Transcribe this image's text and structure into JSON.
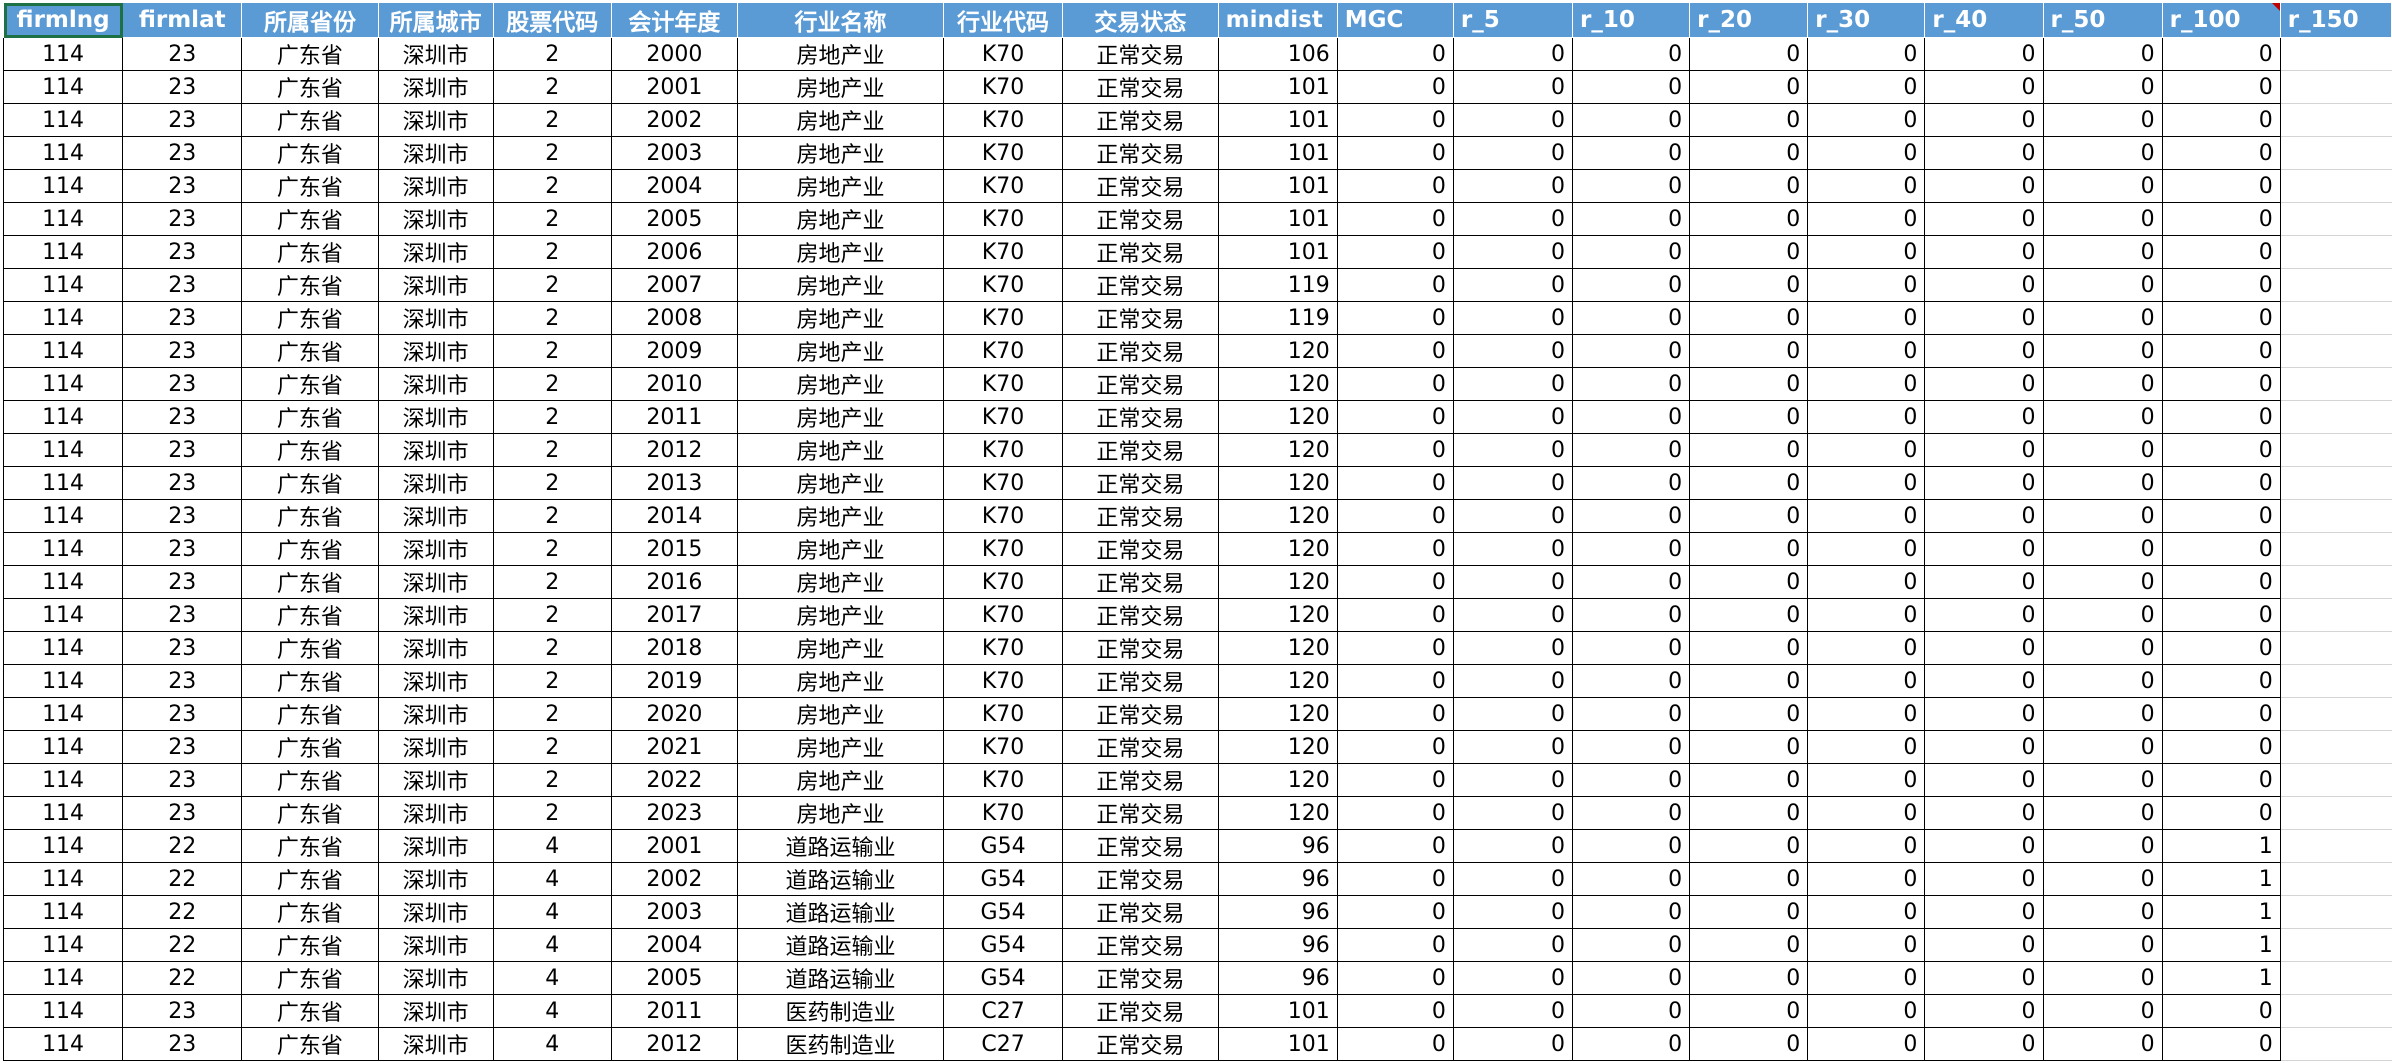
{
  "columns": [
    {
      "label": "firmlng",
      "align": "c",
      "header_align": "c"
    },
    {
      "label": "firmlat",
      "align": "c",
      "header_align": "c"
    },
    {
      "label": "所属省份",
      "align": "c",
      "header_align": "c"
    },
    {
      "label": "所属城市",
      "align": "c",
      "header_align": "c"
    },
    {
      "label": "股票代码",
      "align": "c",
      "header_align": "c"
    },
    {
      "label": "会计年度",
      "align": "c",
      "header_align": "c"
    },
    {
      "label": "行业名称",
      "align": "c",
      "header_align": "c"
    },
    {
      "label": "行业代码",
      "align": "c",
      "header_align": "c"
    },
    {
      "label": "交易状态",
      "align": "c",
      "header_align": "c"
    },
    {
      "label": "mindist",
      "align": "r",
      "header_align": "l"
    },
    {
      "label": "MGC",
      "align": "r",
      "header_align": "l"
    },
    {
      "label": "r_5",
      "align": "r",
      "header_align": "l"
    },
    {
      "label": "r_10",
      "align": "r",
      "header_align": "l"
    },
    {
      "label": "r_20",
      "align": "r",
      "header_align": "l"
    },
    {
      "label": "r_30",
      "align": "r",
      "header_align": "l"
    },
    {
      "label": "r_40",
      "align": "r",
      "header_align": "l"
    },
    {
      "label": "r_50",
      "align": "r",
      "header_align": "l"
    },
    {
      "label": "r_100",
      "align": "r",
      "header_align": "l"
    },
    {
      "label": "r_150",
      "align": "r",
      "header_align": "l"
    }
  ],
  "rows": [
    [
      "114",
      "23",
      "广东省",
      "深圳市",
      "2",
      "2000",
      "房地产业",
      "K70",
      "正常交易",
      "106",
      "0",
      "0",
      "0",
      "0",
      "0",
      "0",
      "0",
      "0",
      ""
    ],
    [
      "114",
      "23",
      "广东省",
      "深圳市",
      "2",
      "2001",
      "房地产业",
      "K70",
      "正常交易",
      "101",
      "0",
      "0",
      "0",
      "0",
      "0",
      "0",
      "0",
      "0",
      ""
    ],
    [
      "114",
      "23",
      "广东省",
      "深圳市",
      "2",
      "2002",
      "房地产业",
      "K70",
      "正常交易",
      "101",
      "0",
      "0",
      "0",
      "0",
      "0",
      "0",
      "0",
      "0",
      ""
    ],
    [
      "114",
      "23",
      "广东省",
      "深圳市",
      "2",
      "2003",
      "房地产业",
      "K70",
      "正常交易",
      "101",
      "0",
      "0",
      "0",
      "0",
      "0",
      "0",
      "0",
      "0",
      ""
    ],
    [
      "114",
      "23",
      "广东省",
      "深圳市",
      "2",
      "2004",
      "房地产业",
      "K70",
      "正常交易",
      "101",
      "0",
      "0",
      "0",
      "0",
      "0",
      "0",
      "0",
      "0",
      ""
    ],
    [
      "114",
      "23",
      "广东省",
      "深圳市",
      "2",
      "2005",
      "房地产业",
      "K70",
      "正常交易",
      "101",
      "0",
      "0",
      "0",
      "0",
      "0",
      "0",
      "0",
      "0",
      ""
    ],
    [
      "114",
      "23",
      "广东省",
      "深圳市",
      "2",
      "2006",
      "房地产业",
      "K70",
      "正常交易",
      "101",
      "0",
      "0",
      "0",
      "0",
      "0",
      "0",
      "0",
      "0",
      ""
    ],
    [
      "114",
      "23",
      "广东省",
      "深圳市",
      "2",
      "2007",
      "房地产业",
      "K70",
      "正常交易",
      "119",
      "0",
      "0",
      "0",
      "0",
      "0",
      "0",
      "0",
      "0",
      ""
    ],
    [
      "114",
      "23",
      "广东省",
      "深圳市",
      "2",
      "2008",
      "房地产业",
      "K70",
      "正常交易",
      "119",
      "0",
      "0",
      "0",
      "0",
      "0",
      "0",
      "0",
      "0",
      ""
    ],
    [
      "114",
      "23",
      "广东省",
      "深圳市",
      "2",
      "2009",
      "房地产业",
      "K70",
      "正常交易",
      "120",
      "0",
      "0",
      "0",
      "0",
      "0",
      "0",
      "0",
      "0",
      ""
    ],
    [
      "114",
      "23",
      "广东省",
      "深圳市",
      "2",
      "2010",
      "房地产业",
      "K70",
      "正常交易",
      "120",
      "0",
      "0",
      "0",
      "0",
      "0",
      "0",
      "0",
      "0",
      ""
    ],
    [
      "114",
      "23",
      "广东省",
      "深圳市",
      "2",
      "2011",
      "房地产业",
      "K70",
      "正常交易",
      "120",
      "0",
      "0",
      "0",
      "0",
      "0",
      "0",
      "0",
      "0",
      ""
    ],
    [
      "114",
      "23",
      "广东省",
      "深圳市",
      "2",
      "2012",
      "房地产业",
      "K70",
      "正常交易",
      "120",
      "0",
      "0",
      "0",
      "0",
      "0",
      "0",
      "0",
      "0",
      ""
    ],
    [
      "114",
      "23",
      "广东省",
      "深圳市",
      "2",
      "2013",
      "房地产业",
      "K70",
      "正常交易",
      "120",
      "0",
      "0",
      "0",
      "0",
      "0",
      "0",
      "0",
      "0",
      ""
    ],
    [
      "114",
      "23",
      "广东省",
      "深圳市",
      "2",
      "2014",
      "房地产业",
      "K70",
      "正常交易",
      "120",
      "0",
      "0",
      "0",
      "0",
      "0",
      "0",
      "0",
      "0",
      ""
    ],
    [
      "114",
      "23",
      "广东省",
      "深圳市",
      "2",
      "2015",
      "房地产业",
      "K70",
      "正常交易",
      "120",
      "0",
      "0",
      "0",
      "0",
      "0",
      "0",
      "0",
      "0",
      ""
    ],
    [
      "114",
      "23",
      "广东省",
      "深圳市",
      "2",
      "2016",
      "房地产业",
      "K70",
      "正常交易",
      "120",
      "0",
      "0",
      "0",
      "0",
      "0",
      "0",
      "0",
      "0",
      ""
    ],
    [
      "114",
      "23",
      "广东省",
      "深圳市",
      "2",
      "2017",
      "房地产业",
      "K70",
      "正常交易",
      "120",
      "0",
      "0",
      "0",
      "0",
      "0",
      "0",
      "0",
      "0",
      ""
    ],
    [
      "114",
      "23",
      "广东省",
      "深圳市",
      "2",
      "2018",
      "房地产业",
      "K70",
      "正常交易",
      "120",
      "0",
      "0",
      "0",
      "0",
      "0",
      "0",
      "0",
      "0",
      ""
    ],
    [
      "114",
      "23",
      "广东省",
      "深圳市",
      "2",
      "2019",
      "房地产业",
      "K70",
      "正常交易",
      "120",
      "0",
      "0",
      "0",
      "0",
      "0",
      "0",
      "0",
      "0",
      ""
    ],
    [
      "114",
      "23",
      "广东省",
      "深圳市",
      "2",
      "2020",
      "房地产业",
      "K70",
      "正常交易",
      "120",
      "0",
      "0",
      "0",
      "0",
      "0",
      "0",
      "0",
      "0",
      ""
    ],
    [
      "114",
      "23",
      "广东省",
      "深圳市",
      "2",
      "2021",
      "房地产业",
      "K70",
      "正常交易",
      "120",
      "0",
      "0",
      "0",
      "0",
      "0",
      "0",
      "0",
      "0",
      ""
    ],
    [
      "114",
      "23",
      "广东省",
      "深圳市",
      "2",
      "2022",
      "房地产业",
      "K70",
      "正常交易",
      "120",
      "0",
      "0",
      "0",
      "0",
      "0",
      "0",
      "0",
      "0",
      ""
    ],
    [
      "114",
      "23",
      "广东省",
      "深圳市",
      "2",
      "2023",
      "房地产业",
      "K70",
      "正常交易",
      "120",
      "0",
      "0",
      "0",
      "0",
      "0",
      "0",
      "0",
      "0",
      ""
    ],
    [
      "114",
      "22",
      "广东省",
      "深圳市",
      "4",
      "2001",
      "道路运输业",
      "G54",
      "正常交易",
      "96",
      "0",
      "0",
      "0",
      "0",
      "0",
      "0",
      "0",
      "1",
      ""
    ],
    [
      "114",
      "22",
      "广东省",
      "深圳市",
      "4",
      "2002",
      "道路运输业",
      "G54",
      "正常交易",
      "96",
      "0",
      "0",
      "0",
      "0",
      "0",
      "0",
      "0",
      "1",
      ""
    ],
    [
      "114",
      "22",
      "广东省",
      "深圳市",
      "4",
      "2003",
      "道路运输业",
      "G54",
      "正常交易",
      "96",
      "0",
      "0",
      "0",
      "0",
      "0",
      "0",
      "0",
      "1",
      ""
    ],
    [
      "114",
      "22",
      "广东省",
      "深圳市",
      "4",
      "2004",
      "道路运输业",
      "G54",
      "正常交易",
      "96",
      "0",
      "0",
      "0",
      "0",
      "0",
      "0",
      "0",
      "1",
      ""
    ],
    [
      "114",
      "22",
      "广东省",
      "深圳市",
      "4",
      "2005",
      "道路运输业",
      "G54",
      "正常交易",
      "96",
      "0",
      "0",
      "0",
      "0",
      "0",
      "0",
      "0",
      "1",
      ""
    ],
    [
      "114",
      "23",
      "广东省",
      "深圳市",
      "4",
      "2011",
      "医药制造业",
      "C27",
      "正常交易",
      "101",
      "0",
      "0",
      "0",
      "0",
      "0",
      "0",
      "0",
      "0",
      ""
    ],
    [
      "114",
      "23",
      "广东省",
      "深圳市",
      "4",
      "2012",
      "医药制造业",
      "C27",
      "正常交易",
      "101",
      "0",
      "0",
      "0",
      "0",
      "0",
      "0",
      "0",
      "0",
      ""
    ]
  ],
  "colors": {
    "header_bg": "#5b9bd5",
    "header_text": "#ffffff",
    "active_cell_border": "#1e7145",
    "grid_line": "#000000"
  }
}
